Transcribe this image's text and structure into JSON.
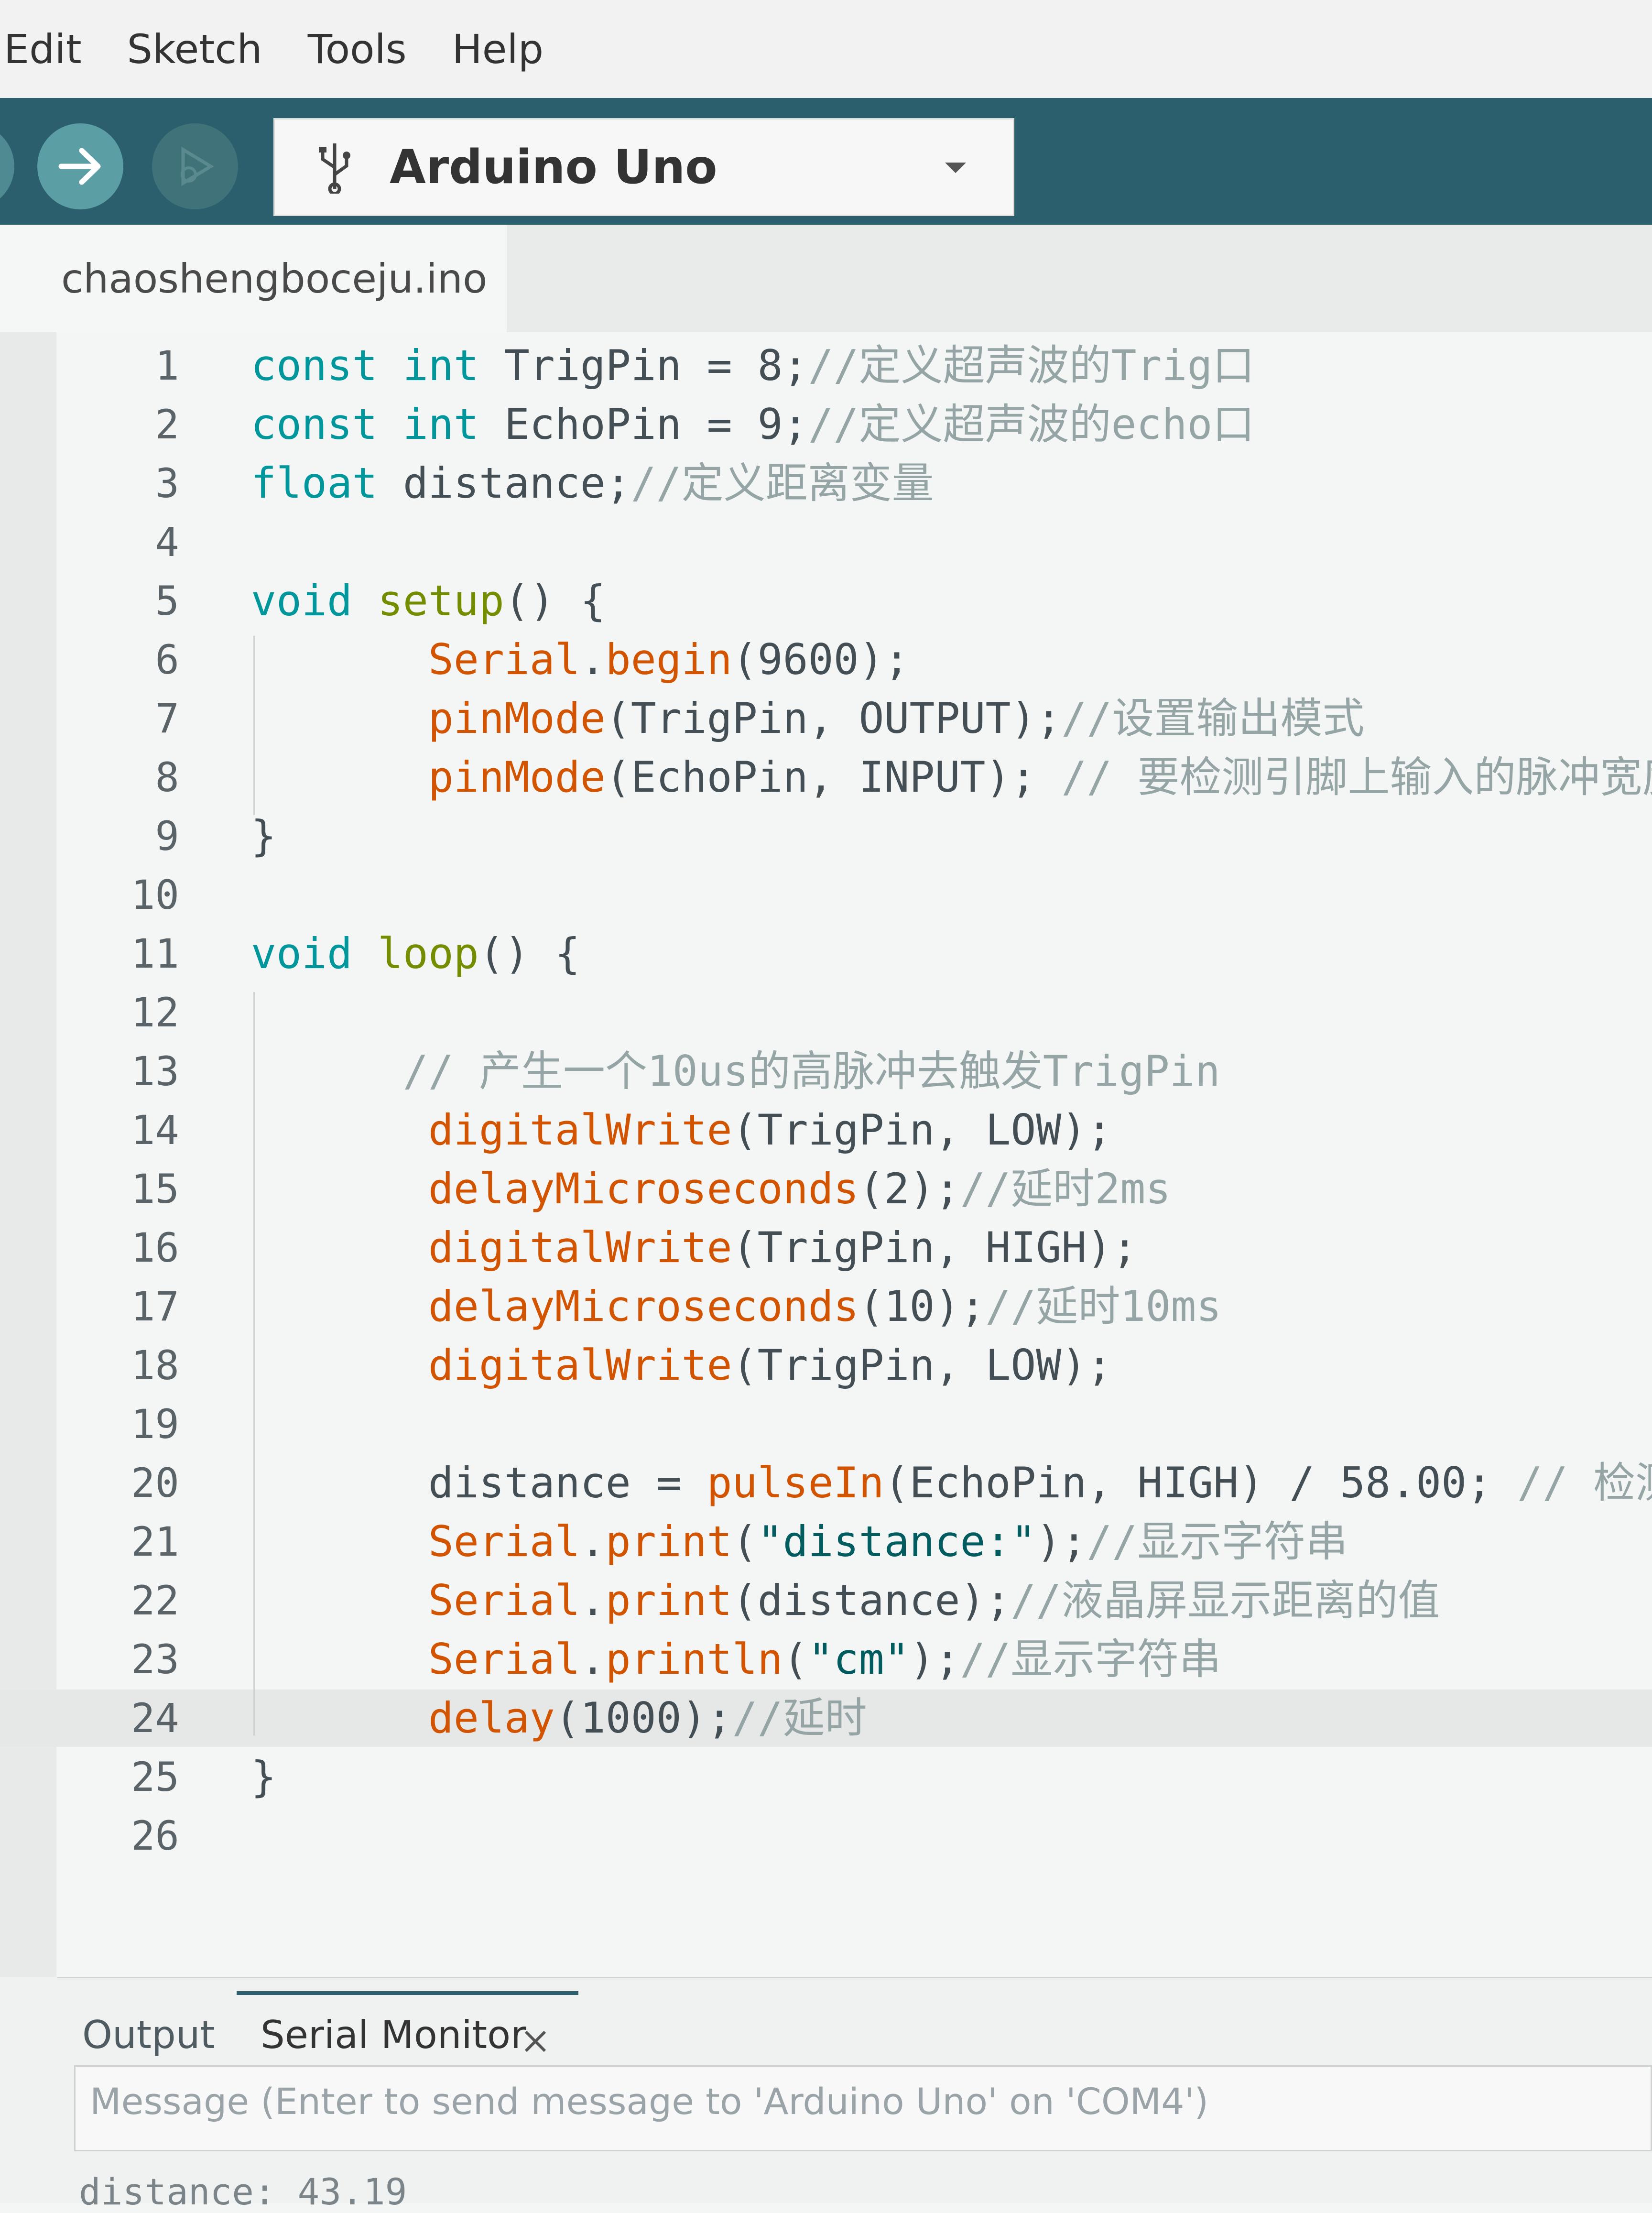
{
  "menu": [
    "Edit",
    "Sketch",
    "Tools",
    "Help"
  ],
  "toolbar": {
    "board": "Arduino Uno"
  },
  "file_tab": "chaoshengboceju.ino",
  "code": [
    {
      "n": "1",
      "segs": [
        [
          "kw",
          "const"
        ],
        [
          "p",
          " "
        ],
        [
          "kw",
          "int"
        ],
        [
          "p",
          " TrigPin = 8;"
        ],
        [
          "cmt",
          "//定义超声波的Trig口"
        ]
      ]
    },
    {
      "n": "2",
      "segs": [
        [
          "kw",
          "const"
        ],
        [
          "p",
          " "
        ],
        [
          "kw",
          "int"
        ],
        [
          "p",
          " EchoPin = 9;"
        ],
        [
          "cmt",
          "//定义超声波的echo口"
        ]
      ]
    },
    {
      "n": "3",
      "segs": [
        [
          "kw",
          "float"
        ],
        [
          "p",
          " distance;"
        ],
        [
          "cmt",
          "//定义距离变量"
        ]
      ]
    },
    {
      "n": "4",
      "segs": []
    },
    {
      "n": "5",
      "segs": [
        [
          "kw",
          "void"
        ],
        [
          "p",
          " "
        ],
        [
          "kw2",
          "setup"
        ],
        [
          "p",
          "() {"
        ]
      ]
    },
    {
      "n": "6",
      "segs": [
        [
          "p",
          "       "
        ],
        [
          "fn",
          "Serial"
        ],
        [
          "p",
          "."
        ],
        [
          "fn",
          "begin"
        ],
        [
          "p",
          "(9600);"
        ]
      ]
    },
    {
      "n": "7",
      "segs": [
        [
          "p",
          "       "
        ],
        [
          "fn",
          "pinMode"
        ],
        [
          "p",
          "(TrigPin, OUTPUT);"
        ],
        [
          "cmt",
          "//设置输出模式"
        ]
      ]
    },
    {
      "n": "8",
      "segs": [
        [
          "p",
          "       "
        ],
        [
          "fn",
          "pinMode"
        ],
        [
          "p",
          "(EchoPin, INPUT); "
        ],
        [
          "cmt",
          "// 要检测引脚上输入的脉冲宽度"
        ]
      ]
    },
    {
      "n": "9",
      "segs": [
        [
          "p",
          "}"
        ]
      ]
    },
    {
      "n": "10",
      "segs": []
    },
    {
      "n": "11",
      "segs": [
        [
          "kw",
          "void"
        ],
        [
          "p",
          " "
        ],
        [
          "kw2",
          "loop"
        ],
        [
          "p",
          "() {"
        ]
      ]
    },
    {
      "n": "12",
      "segs": []
    },
    {
      "n": "13",
      "segs": [
        [
          "p",
          "      "
        ],
        [
          "cmt",
          "// 产生一个10us的高脉冲去触发TrigPin"
        ]
      ]
    },
    {
      "n": "14",
      "segs": [
        [
          "p",
          "       "
        ],
        [
          "fn",
          "digitalWrite"
        ],
        [
          "p",
          "(TrigPin, LOW);"
        ]
      ]
    },
    {
      "n": "15",
      "segs": [
        [
          "p",
          "       "
        ],
        [
          "fn",
          "delayMicroseconds"
        ],
        [
          "p",
          "(2);"
        ],
        [
          "cmt",
          "//延时2ms"
        ]
      ]
    },
    {
      "n": "16",
      "segs": [
        [
          "p",
          "       "
        ],
        [
          "fn",
          "digitalWrite"
        ],
        [
          "p",
          "(TrigPin, HIGH);"
        ]
      ]
    },
    {
      "n": "17",
      "segs": [
        [
          "p",
          "       "
        ],
        [
          "fn",
          "delayMicroseconds"
        ],
        [
          "p",
          "(10);"
        ],
        [
          "cmt",
          "//延时10ms"
        ]
      ]
    },
    {
      "n": "18",
      "segs": [
        [
          "p",
          "       "
        ],
        [
          "fn",
          "digitalWrite"
        ],
        [
          "p",
          "(TrigPin, LOW);"
        ]
      ]
    },
    {
      "n": "19",
      "segs": []
    },
    {
      "n": "20",
      "segs": [
        [
          "p",
          "       distance = "
        ],
        [
          "fn",
          "pulseIn"
        ],
        [
          "p",
          "(EchoPin, HIGH) / 58.00; "
        ],
        [
          "cmt",
          "// 检测脉"
        ]
      ]
    },
    {
      "n": "21",
      "segs": [
        [
          "p",
          "       "
        ],
        [
          "fn",
          "Serial"
        ],
        [
          "p",
          "."
        ],
        [
          "fn",
          "print"
        ],
        [
          "p",
          "("
        ],
        [
          "str",
          "\"distance:\""
        ],
        [
          "p",
          ");"
        ],
        [
          "cmt",
          "//显示字符串"
        ]
      ]
    },
    {
      "n": "22",
      "segs": [
        [
          "p",
          "       "
        ],
        [
          "fn",
          "Serial"
        ],
        [
          "p",
          "."
        ],
        [
          "fn",
          "print"
        ],
        [
          "p",
          "(distance);"
        ],
        [
          "cmt",
          "//液晶屏显示距离的值"
        ]
      ]
    },
    {
      "n": "23",
      "segs": [
        [
          "p",
          "       "
        ],
        [
          "fn",
          "Serial"
        ],
        [
          "p",
          "."
        ],
        [
          "fn",
          "println"
        ],
        [
          "p",
          "("
        ],
        [
          "str",
          "\"cm\""
        ],
        [
          "p",
          ");"
        ],
        [
          "cmt",
          "//显示字符串"
        ]
      ]
    },
    {
      "n": "24",
      "segs": [
        [
          "p",
          "       "
        ],
        [
          "fn",
          "delay"
        ],
        [
          "p",
          "(1000);"
        ],
        [
          "cmt",
          "//延时"
        ]
      ]
    },
    {
      "n": "25",
      "segs": [
        [
          "p",
          "}"
        ]
      ]
    },
    {
      "n": "26",
      "segs": []
    }
  ],
  "bottom": {
    "tab_output": "Output",
    "tab_serial": "Serial Monitor",
    "message_placeholder": "Message (Enter to send message to 'Arduino Uno' on 'COM4')",
    "serial_line": "distance: 43.19"
  },
  "colors": {
    "toolbar": "#2c5f6e",
    "keyword": "#00979c",
    "function": "#d35400",
    "comment": "#95a5a6"
  }
}
